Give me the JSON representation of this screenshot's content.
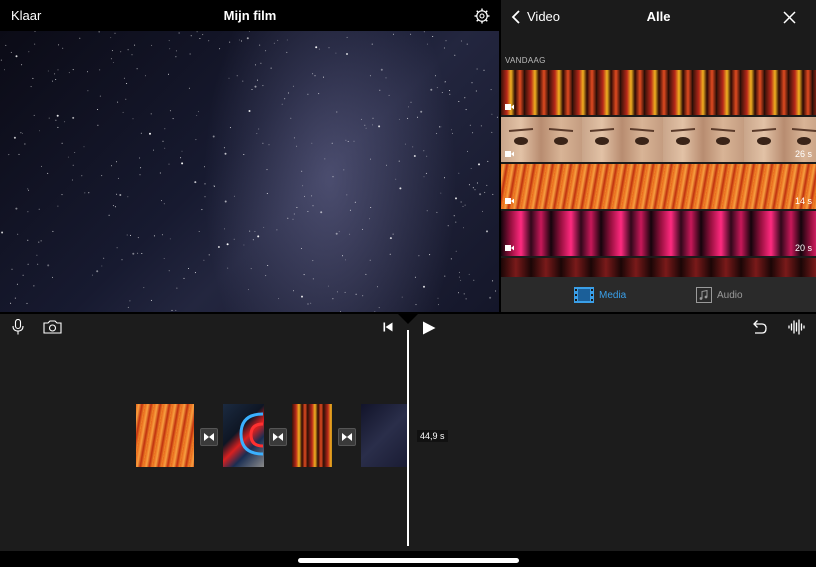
{
  "viewer_header": {
    "done_label": "Klaar",
    "title": "Mijn film"
  },
  "browser_header": {
    "back_label": "Video",
    "title": "Alle"
  },
  "browser": {
    "section_label": "VANDAAG",
    "rows": [
      {
        "duration": "",
        "theme": "city"
      },
      {
        "duration": "26 s",
        "theme": "eyes"
      },
      {
        "duration": "14 s",
        "theme": "lights"
      },
      {
        "duration": "20 s",
        "theme": "vacancy"
      }
    ],
    "tabs": {
      "media": "Media",
      "audio": "Audio"
    }
  },
  "timeline": {
    "playhead_time": "44,9 s"
  },
  "colors": {
    "accent": "#3a9fe8",
    "background": "#1c1c1c"
  }
}
